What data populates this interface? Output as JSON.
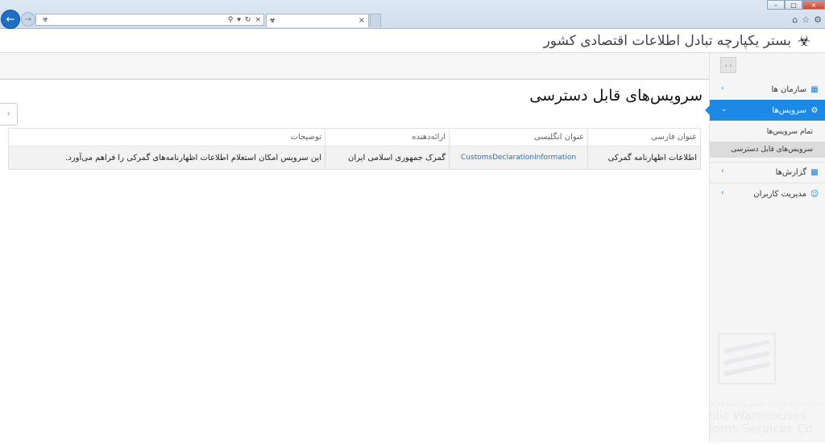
{
  "browser": {
    "tab_title": "",
    "icons": {
      "back": "arrow-left-icon",
      "forward": "arrow-right-icon",
      "home": "home-icon",
      "favorites": "star-icon",
      "settings": "gear-icon"
    }
  },
  "header": {
    "site_title": "بستر یکپارچه تبادل اطلاعات اقتصادی کشور"
  },
  "sidebar": {
    "items": [
      {
        "label": "سازمان ها",
        "icon": "building-icon"
      },
      {
        "label": "سرویس‌ها",
        "icon": "gear-icon"
      },
      {
        "label": "گزارش‌ها",
        "icon": "bar-chart-icon"
      },
      {
        "label": "مدیریت کاربران",
        "icon": "user-icon"
      }
    ],
    "sub_items": [
      {
        "label": "تمام سرویس‌ها"
      },
      {
        "label": "سرویس‌های قابل دسترسی"
      }
    ],
    "watermark": {
      "line1": "شرکت خدمات انبارهای عمومی و خدمات گمرکی",
      "line2": "blic Warehouses",
      "line3": "toms Services Co"
    }
  },
  "main": {
    "page_title": "سرویس‌های قابل دسترسی",
    "table": {
      "columns": [
        "عنوان فارسی",
        "عنوان انگلیسی",
        "ارائه‌دهنده",
        "توضیحات"
      ],
      "rows": [
        {
          "persian_title": "اطلاعات اظهارنامه گمرکی",
          "english_title": "CustomsDeclarationInformation",
          "provider": "گمرک جمهوری اسلامی ایران",
          "description": "این سرویس امکان استعلام اطلاعات اظهارنامه‌های گمرکی را فراهم می‌آورد."
        }
      ]
    }
  }
}
